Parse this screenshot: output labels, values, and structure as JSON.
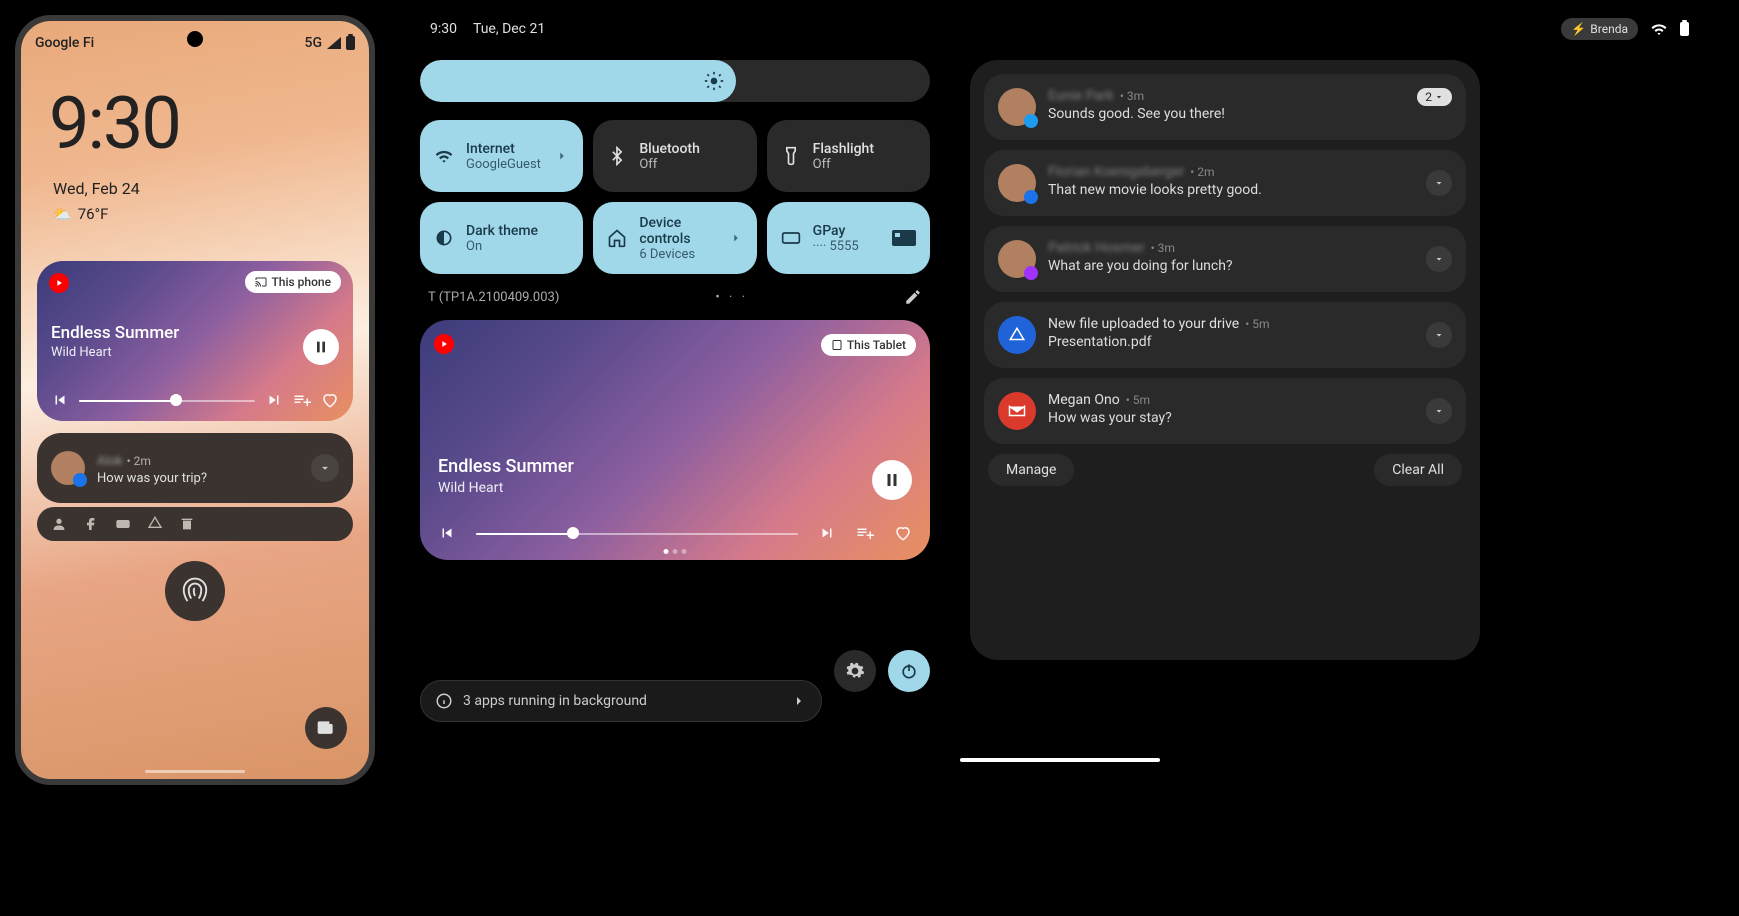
{
  "phone": {
    "carrier": "Google Fi",
    "network": "5G",
    "clock": "9:30",
    "date": "Wed, Feb 24",
    "temperature": "76°F",
    "media": {
      "cast_label": "This phone",
      "title": "Endless Summer",
      "artist": "Wild Heart"
    },
    "notification": {
      "sender": "Alok",
      "time": "2m",
      "message": "How was your trip?"
    }
  },
  "tablet": {
    "clock": "9:30",
    "date": "Tue, Dec 21",
    "user_chip": "Brenda",
    "brightness_pct": 62,
    "build_label": "T (TP1A.2100409.003)",
    "tiles": [
      {
        "title": "Internet",
        "subtitle": "GoogleGuest",
        "on": true,
        "icon": "wifi",
        "chevron": true
      },
      {
        "title": "Bluetooth",
        "subtitle": "Off",
        "on": false,
        "icon": "bluetooth",
        "chevron": false
      },
      {
        "title": "Flashlight",
        "subtitle": "Off",
        "on": false,
        "icon": "flashlight",
        "chevron": false
      },
      {
        "title": "Dark theme",
        "subtitle": "On",
        "on": true,
        "icon": "darktheme",
        "chevron": false
      },
      {
        "title": "Device controls",
        "subtitle": "6 Devices",
        "on": true,
        "icon": "home",
        "chevron": true
      },
      {
        "title": "GPay",
        "subtitle": "···· 5555",
        "on": true,
        "icon": "card",
        "chevron": false,
        "trailing": "card-graphic"
      }
    ],
    "media": {
      "cast_label": "This Tablet",
      "title": "Endless Summer",
      "artist": "Wild Heart"
    },
    "bg_apps_text": "3 apps running in background",
    "notifications": [
      {
        "sender_blur": "Eunie Park",
        "time": "3m",
        "message": "Sounds good. See you there!",
        "count": "2",
        "badge": "twitter",
        "avatar": "photo"
      },
      {
        "sender_blur": "Florian Koenigsberger",
        "time": "2m",
        "message": "That new movie looks pretty good.",
        "badge": "messages",
        "avatar": "photo"
      },
      {
        "sender_blur": "Patrick Hosmer",
        "time": "3m",
        "message": "What are you doing for lunch?",
        "badge": "messenger",
        "avatar": "photo"
      },
      {
        "title": "New file uploaded to your drive",
        "time": "5m",
        "message": "Presentation.pdf",
        "icon": "drive"
      },
      {
        "title": "Megan Ono",
        "time": "5m",
        "message": "How was your stay?",
        "icon": "gmail"
      }
    ],
    "manage_label": "Manage",
    "clear_all_label": "Clear All"
  }
}
